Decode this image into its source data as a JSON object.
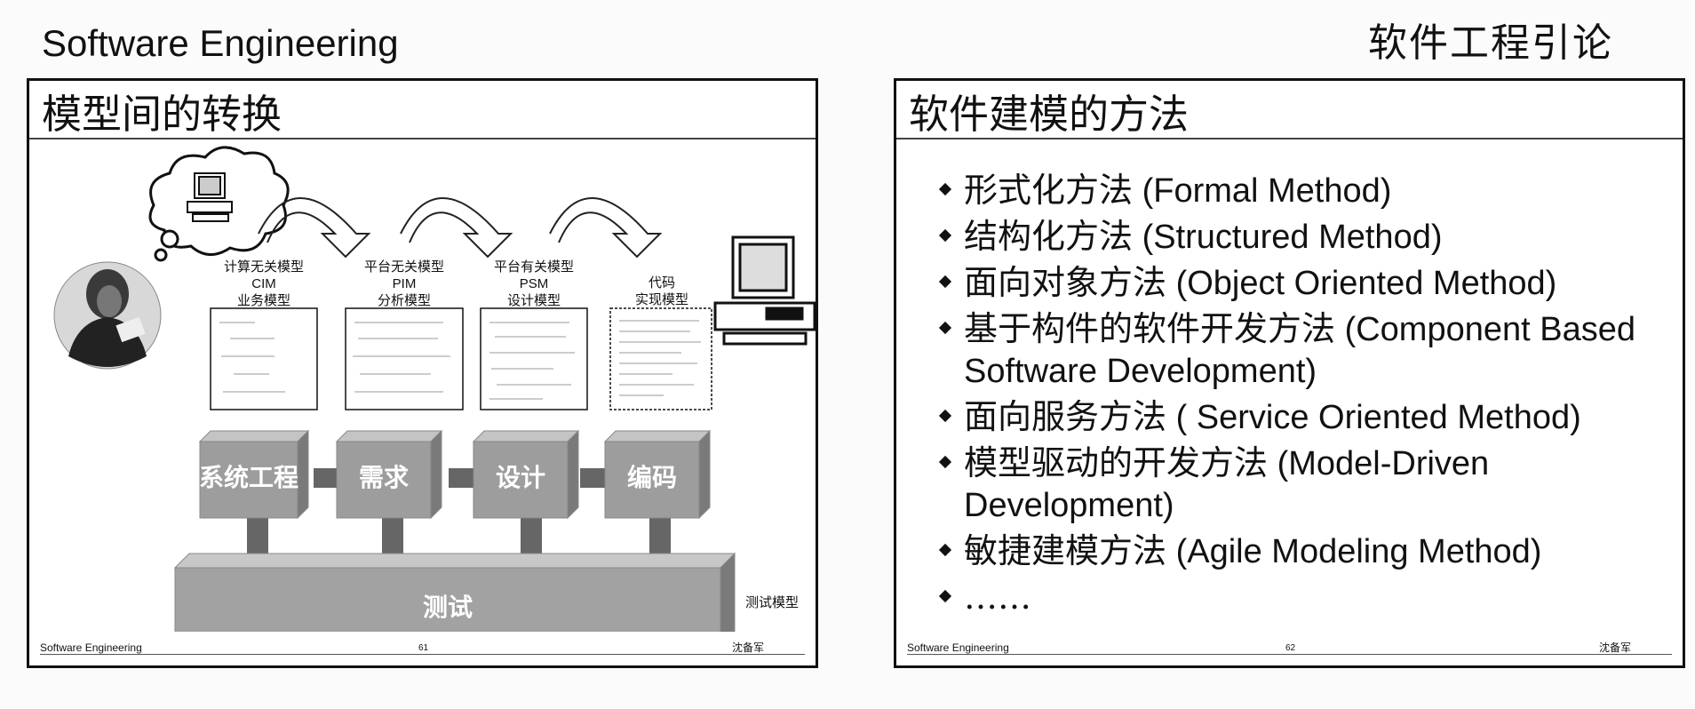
{
  "header": {
    "left_title": "Software Engineering",
    "right_title": "软件工程引论"
  },
  "slide1": {
    "title": "模型间的转换",
    "footer_left": "Software Engineering",
    "footer_page": "61",
    "footer_right": "沈备军",
    "models": [
      {
        "line1": "计算无关模型",
        "line2": "CIM",
        "line3": "业务模型"
      },
      {
        "line1": "平台无关模型",
        "line2": "PIM",
        "line3": "分析模型"
      },
      {
        "line1": "平台有关模型",
        "line2": "PSM",
        "line3": "设计模型"
      },
      {
        "line1": "代码",
        "line2": "实现模型"
      }
    ],
    "stages": [
      "系统工程",
      "需求",
      "设计",
      "编码"
    ],
    "test_stage": "测试",
    "test_model": "测试模型"
  },
  "slide2": {
    "title": "软件建模的方法",
    "footer_left": "Software Engineering",
    "footer_page": "62",
    "footer_right": "沈备军",
    "items": [
      {
        "zh": "形式化方法",
        "en": " (Formal Method)"
      },
      {
        "zh": "结构化方法",
        "en": " (Structured Method)"
      },
      {
        "zh": "面向对象方法",
        "en": " (Object Oriented Method)"
      },
      {
        "zh": "基于构件的软件开发方法",
        "en": " (Component Based Software Development)"
      },
      {
        "zh": "面向服务方法",
        "en": " ( Service Oriented Method)"
      },
      {
        "zh": "模型驱动的开发方法",
        "en": " (Model-Driven Development)"
      },
      {
        "zh": "敏捷建模方法",
        "en": " (Agile Modeling Method)"
      },
      {
        "zh": "……",
        "en": ""
      }
    ]
  }
}
